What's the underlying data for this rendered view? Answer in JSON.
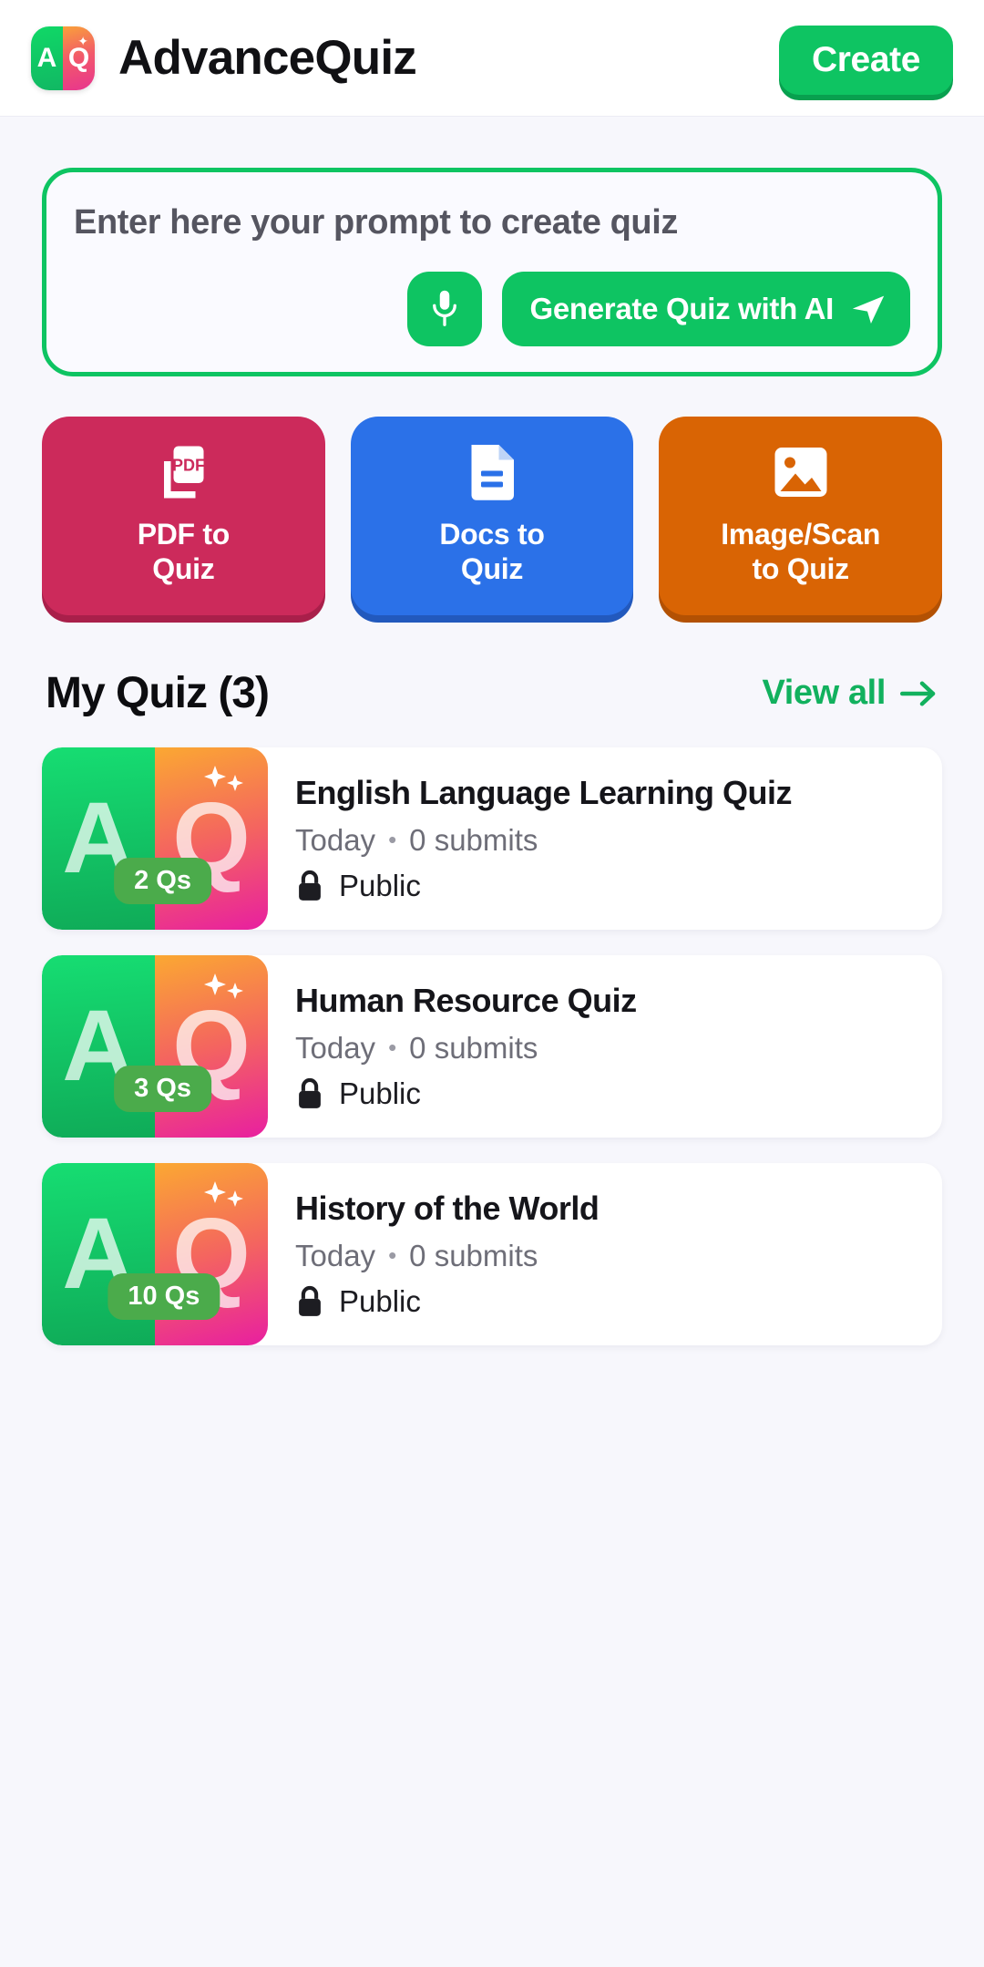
{
  "header": {
    "logo": {
      "left_letter": "A",
      "right_letter": "Q",
      "sparkle_icon": "sparkle-icon"
    },
    "title": "AdvanceQuiz",
    "create_label": "Create"
  },
  "prompt": {
    "placeholder": "Enter here your prompt to create quiz",
    "value": "",
    "mic_icon": "microphone-icon",
    "generate_label": "Generate Quiz with AI",
    "send_icon": "send-icon"
  },
  "categories": [
    {
      "label": "PDF to\nQuiz",
      "line1": "PDF to",
      "line2": "Quiz",
      "icon": "pdf-file-icon",
      "color": "#cc2a5b"
    },
    {
      "label": "Docs to\nQuiz",
      "line1": "Docs to",
      "line2": "Quiz",
      "icon": "document-file-icon",
      "color": "#2b71e8"
    },
    {
      "label": "Image/Scan\nto Quiz",
      "line1": "Image/Scan",
      "line2": "to Quiz",
      "icon": "image-picture-icon",
      "color": "#d96404"
    }
  ],
  "my_quiz": {
    "title": "My Quiz (3)",
    "view_all_label": "View all",
    "view_all_icon": "arrow-right-icon",
    "accent_color": "#12b15e"
  },
  "quizzes": [
    {
      "title": "English Language Learning Quiz",
      "date": "Today",
      "separator": "•",
      "submits": "0 submits",
      "visibility": "Public",
      "lock_icon": "lock-icon",
      "questions_badge": "2 Qs",
      "thumb_left_letter": "A",
      "thumb_right_letter": "Q"
    },
    {
      "title": "Human Resource Quiz",
      "date": "Today",
      "separator": "•",
      "submits": "0 submits",
      "visibility": "Public",
      "lock_icon": "lock-icon",
      "questions_badge": "3 Qs",
      "thumb_left_letter": "A",
      "thumb_right_letter": "Q"
    },
    {
      "title": "History of the World",
      "date": "Today",
      "separator": "•",
      "submits": "0 submits",
      "visibility": "Public",
      "lock_icon": "lock-icon",
      "questions_badge": "10 Qs",
      "thumb_left_letter": "A",
      "thumb_right_letter": "Q"
    }
  ]
}
